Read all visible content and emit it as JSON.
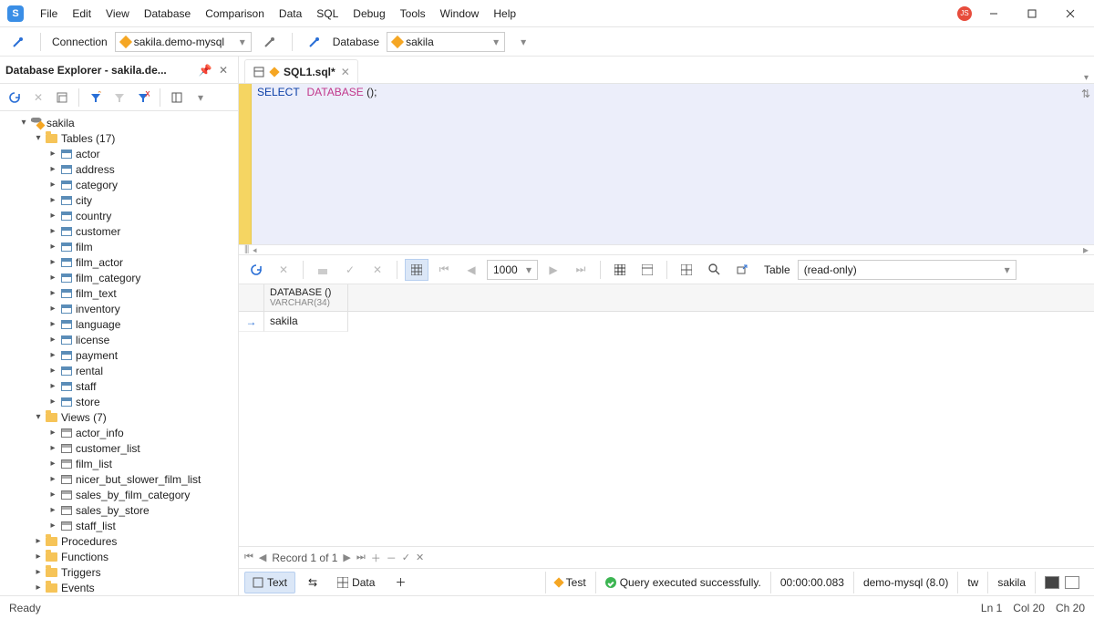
{
  "menu": [
    "File",
    "Edit",
    "View",
    "Database",
    "Comparison",
    "Data",
    "SQL",
    "Debug",
    "Tools",
    "Window",
    "Help"
  ],
  "connbar": {
    "connection_label": "Connection",
    "connection_value": "sakila.demo-mysql",
    "database_label": "Database",
    "database_value": "sakila"
  },
  "explorer": {
    "title": "Database Explorer - sakila.de...",
    "root": "sakila",
    "tables_label": "Tables (17)",
    "tables": [
      "actor",
      "address",
      "category",
      "city",
      "country",
      "customer",
      "film",
      "film_actor",
      "film_category",
      "film_text",
      "inventory",
      "language",
      "license",
      "payment",
      "rental",
      "staff",
      "store"
    ],
    "views_label": "Views (7)",
    "views": [
      "actor_info",
      "customer_list",
      "film_list",
      "nicer_but_slower_film_list",
      "sales_by_film_category",
      "sales_by_store",
      "staff_list"
    ],
    "folders": [
      "Procedures",
      "Functions",
      "Triggers",
      "Events"
    ]
  },
  "tab": {
    "name": "SQL1.sql*"
  },
  "code": {
    "kw1": "SELECT",
    "kw2": "DATABASE",
    "rest": " ();"
  },
  "results": {
    "page_size": "1000",
    "mode_label": "Table",
    "mode_value": "(read-only)",
    "column_name": "DATABASE ()",
    "column_type": "VARCHAR(34)",
    "cell": "sakila",
    "nav": "Record 1 of 1"
  },
  "bottom": {
    "tab_text": "Text",
    "tab_data": "Data",
    "test": "Test",
    "exec_msg": "Query executed successfully.",
    "time": "00:00:00.083",
    "server": "demo-mysql (8.0)",
    "user": "tw",
    "db": "sakila"
  },
  "status": {
    "ready": "Ready",
    "ln": "Ln 1",
    "col": "Col 20",
    "ch": "Ch 20"
  }
}
